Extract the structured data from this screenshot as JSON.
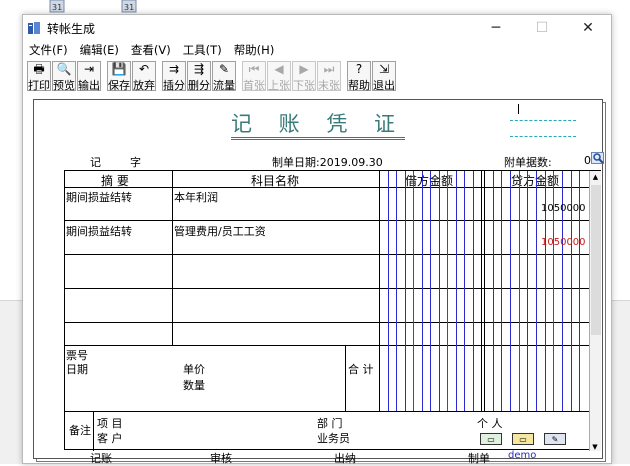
{
  "window": {
    "title": "转帐生成"
  },
  "menu": [
    "文件(F)",
    "编辑(E)",
    "查看(V)",
    "工具(T)",
    "帮助(H)"
  ],
  "toolbar": [
    {
      "label": "打印",
      "icon": "printer-icon",
      "glyph": "🖶",
      "enabled": true
    },
    {
      "label": "预览",
      "icon": "preview-icon",
      "glyph": "🔍",
      "enabled": true
    },
    {
      "label": "输出",
      "icon": "export-icon",
      "glyph": "⇥",
      "enabled": true
    },
    {
      "label": "保存",
      "icon": "save-icon",
      "glyph": "💾",
      "enabled": true
    },
    {
      "label": "放弃",
      "icon": "undo-icon",
      "glyph": "↶",
      "enabled": true
    },
    {
      "label": "插分",
      "icon": "insert-row-icon",
      "glyph": "⇉",
      "enabled": true
    },
    {
      "label": "删分",
      "icon": "delete-row-icon",
      "glyph": "⇶",
      "enabled": true
    },
    {
      "label": "流量",
      "icon": "flow-icon",
      "glyph": "✎",
      "enabled": true
    },
    {
      "label": "首张",
      "icon": "first-icon",
      "glyph": "⏮",
      "enabled": false
    },
    {
      "label": "上张",
      "icon": "prev-icon",
      "glyph": "◀",
      "enabled": false
    },
    {
      "label": "下张",
      "icon": "next-icon",
      "glyph": "▶",
      "enabled": false
    },
    {
      "label": "末张",
      "icon": "last-icon",
      "glyph": "⏭",
      "enabled": false
    },
    {
      "label": "帮助",
      "icon": "help-icon",
      "glyph": "?",
      "enabled": true
    },
    {
      "label": "退出",
      "icon": "exit-icon",
      "glyph": "⇲",
      "enabled": true
    }
  ],
  "voucher": {
    "title": "记 账 凭 证",
    "type_label": "记",
    "number_label": "字",
    "date_text": "制单日期:2019.09.30",
    "attachments_label": "附单据数:",
    "attachments_value": "0",
    "columns": {
      "summary": "摘 要",
      "account": "科目名称",
      "debit": "借方金额",
      "credit": "贷方金额"
    },
    "rows": [
      {
        "summary": "期间损益结转",
        "account": "本年利润",
        "debit": "",
        "credit": "1050000"
      },
      {
        "summary": "期间损益结转",
        "account": "管理费用/员工工资",
        "debit": "",
        "credit": "1050000"
      },
      {
        "summary": "",
        "account": "",
        "debit": "",
        "credit": ""
      },
      {
        "summary": "",
        "account": "",
        "debit": "",
        "credit": ""
      },
      {
        "summary": "",
        "account": "",
        "debit": "",
        "credit": ""
      }
    ],
    "bill_no_label": "票号",
    "date_label": "日期",
    "unit_price_label": "单价",
    "quantity_label": "数量",
    "total_label": "合 计",
    "remarks_label": "备注",
    "project_label": "项  目",
    "customer_label": "客  户",
    "dept_label": "部  门",
    "person_label": "个  人",
    "salesman_label": "业务员"
  },
  "footer": {
    "bookkeeping_label": "记账",
    "review_label": "审核",
    "cashier_label": "出纳",
    "preparer_label": "制单",
    "preparer_value": "demo"
  },
  "colors": {
    "title": "#3a7b7a",
    "credit_line2": "#c12020",
    "grid_blue": "#2a2ad0"
  }
}
